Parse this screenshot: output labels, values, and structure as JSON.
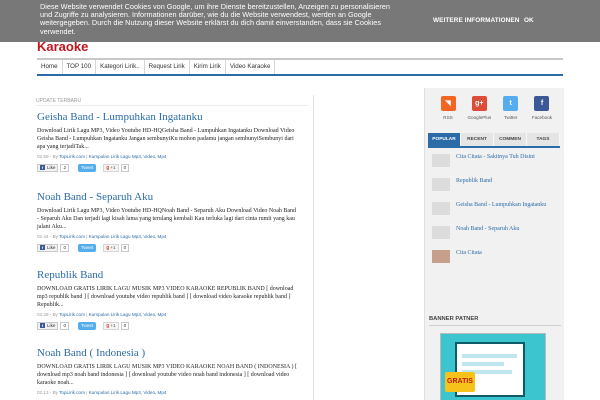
{
  "cookie": {
    "text": "Diese Website verwendet Cookies von Google, um ihre Dienste bereitzustellen, Anzeigen zu personalisieren und Zugriffe zu analysieren. Informationen darüber, wie du die Website verwendest, werden an Google weitergegeben. Durch die Nutzung dieser Website erklärst du dich damit einverstanden, dass sie Cookies verwendet.",
    "more_label": "WEITERE INFORMATIONEN",
    "ok_label": "OK"
  },
  "header": {
    "logo": "Karaoke"
  },
  "nav": {
    "items": [
      {
        "label": "Home"
      },
      {
        "label": "TOP 100"
      },
      {
        "label": "Kategori Lirik.."
      },
      {
        "label": "Request Lirik"
      },
      {
        "label": "Kirim Lirik"
      },
      {
        "label": "Video Karaoke"
      }
    ]
  },
  "main": {
    "section_label": "UPDATE TERBARU",
    "share": {
      "like_label": "Like",
      "tweet_label": "Tweet",
      "gplus_label": "+1"
    },
    "posts": [
      {
        "title": "Geisha Band - Lumpuhkan Ingatanku",
        "snippet": "Download Lirik Lagu MP3, Video Youtube HD-HQGeisha Band - Lumpuhkan Ingatanku   Download Video Geisha Band - Lumpuhkan Ingatanku Jangan sembunyiKu mohon padamu jangan sembunyiSembunyi dari apa yang terjadiTak...",
        "time": "02.59",
        "author": "TopLirik.com",
        "labels": "Kumpulan Lirik Lagu Mp3, Video, Mp4",
        "like_count": "2",
        "gplus_count": "0"
      },
      {
        "title": "Noah Band - Separuh Aku",
        "snippet": "Download Lirik Lagu MP3, Video Youtube HD-HQNoah Band - Separuh Aku   Download Video Noah Band - Separuh Aku Dan terjadi lagi kisah lama yang terulang kembali Kau terluka lagi dari cinta rumit yang kau jalani Aku...",
        "time": "02.44",
        "author": "TopLirik.com",
        "labels": "Kumpulan Lirik Lagu Mp3, Video, Mp4",
        "like_count": "0",
        "gplus_count": "0"
      },
      {
        "title": "Republik Band",
        "snippet": "DOWNLOAD GRATIS LIRIK LAGU MUSIK MP3 VIDEO KARAOKE  REPUBLIK BAND [ download mp3 republik band ] [ download youtube video republik band ] [ download video karaoke republik band ] Republik...",
        "time": "02.28",
        "author": "TopLirik.com",
        "labels": "Kumpulan Lirik Lagu Mp3, Video, Mp4",
        "like_count": "0",
        "gplus_count": "0"
      },
      {
        "title": "Noah Band ( Indonesia )",
        "snippet": "DOWNLOAD GRATIS LIRIK LAGU MUSIK MP3 VIDEO KARAOKE  NOAH BAND ( INDONESIA ) [ download mp3 noah band indonesia ] [ download youtube video noah band indonesia ] [ download video karaoke noah...",
        "time": "02.13",
        "author": "TopLirik.com",
        "labels": "Kumpulan Lirik Lagu Mp3, Video, Mp4",
        "like_count": "",
        "gplus_count": ""
      }
    ]
  },
  "sidebar": {
    "social": [
      {
        "label": "RSS",
        "icon": "rss-icon",
        "color": "#f26522",
        "glyph": "◥"
      },
      {
        "label": "GooglePlus",
        "icon": "google-plus-icon",
        "color": "#dd4b39",
        "glyph": "g+"
      },
      {
        "label": "Twitter",
        "icon": "twitter-icon",
        "color": "#55acee",
        "glyph": "t"
      },
      {
        "label": "Facebook",
        "icon": "facebook-icon",
        "color": "#3b5998",
        "glyph": "f"
      }
    ],
    "tabs": [
      {
        "label": "POPULAR"
      },
      {
        "label": "RECENT"
      },
      {
        "label": "COMMEN"
      },
      {
        "label": "TAGS"
      }
    ],
    "popular": [
      {
        "title": "Cita Citata - Sakitnya Tuh Disini"
      },
      {
        "title": "Republik Band"
      },
      {
        "title": "Geisha Band - Lumpuhkan Ingatanku"
      },
      {
        "title": "Noah Band - Separuh Aku"
      },
      {
        "title": "Cita Citata"
      }
    ],
    "banner_label": "BANNER PATNER",
    "banner_badge": "GRATIS"
  },
  "colors": {
    "accent": "#2b6ca8",
    "logo": "#c0171d"
  }
}
